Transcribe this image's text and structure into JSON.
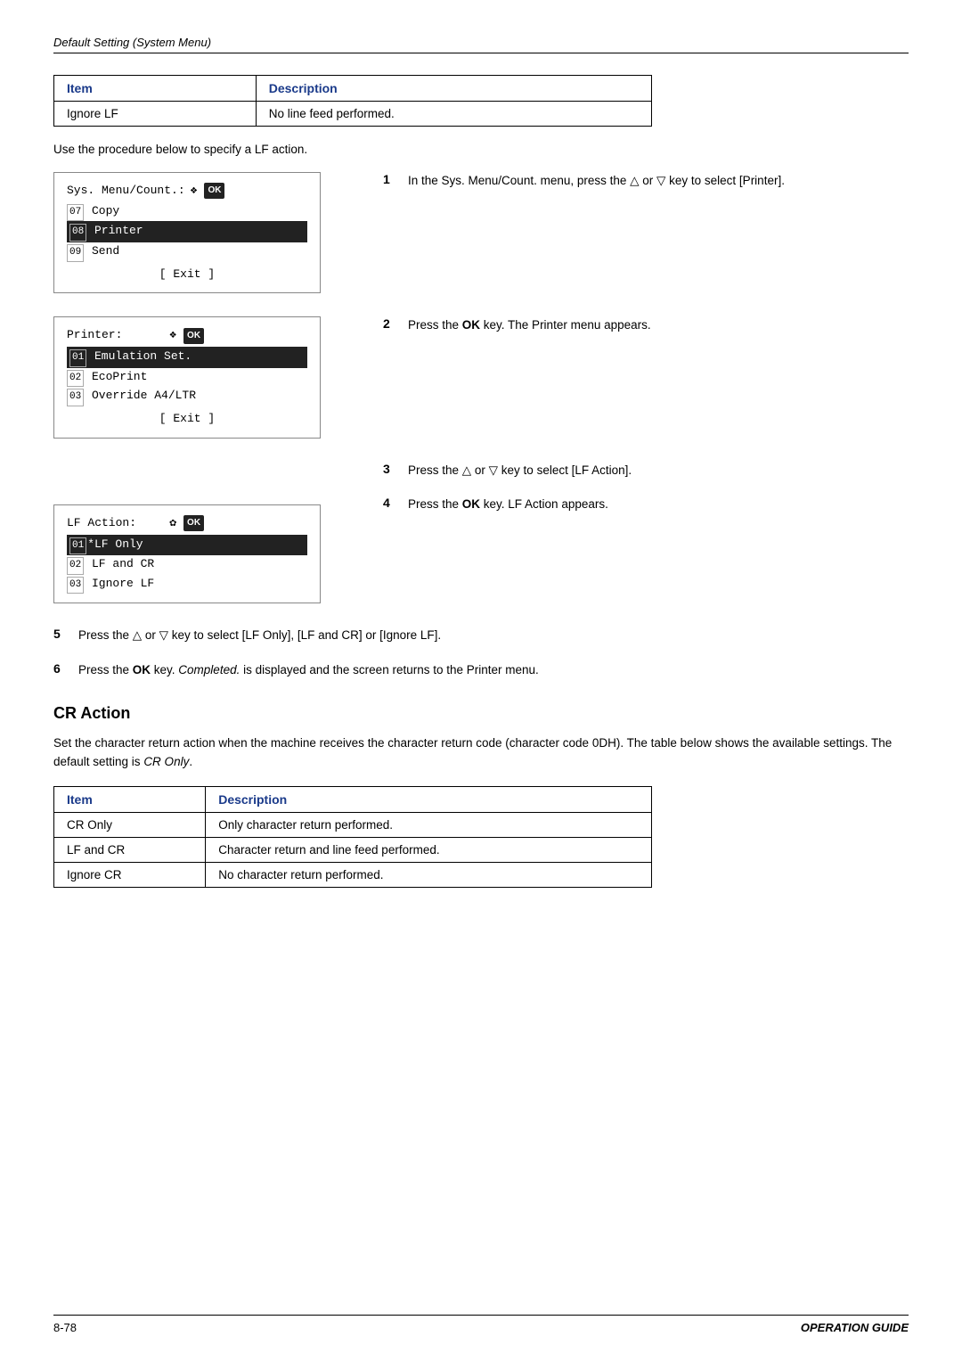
{
  "header": {
    "title": "Default Setting (System Menu)"
  },
  "lf_action_table": {
    "col1": "Item",
    "col2": "Description",
    "rows": [
      {
        "item": "Ignore LF",
        "description": "No line feed performed."
      }
    ]
  },
  "procedure_intro": "Use the procedure below to specify a LF action.",
  "lcd_screens": {
    "screen1": {
      "title": "Sys. Menu/Count.:",
      "rows": [
        {
          "num": "07",
          "text": "Copy",
          "highlighted": false
        },
        {
          "num": "08",
          "text": "Printer",
          "highlighted": true
        },
        {
          "num": "09",
          "text": "Send",
          "highlighted": false
        }
      ],
      "exit": "[ Exit ]"
    },
    "screen2": {
      "title": "Printer:",
      "rows": [
        {
          "num": "01",
          "text": "Emulation Set.",
          "highlighted": true
        },
        {
          "num": "02",
          "text": "EcoPrint",
          "highlighted": false
        },
        {
          "num": "03",
          "text": "Override A4/LTR",
          "highlighted": false
        }
      ],
      "exit": "[ Exit ]"
    },
    "screen3": {
      "title": "LF Action:",
      "rows": [
        {
          "num": "01",
          "text": "*LF Only",
          "highlighted": true
        },
        {
          "num": "02",
          "text": "LF and CR",
          "highlighted": false
        },
        {
          "num": "03",
          "text": "Ignore LF",
          "highlighted": false
        }
      ]
    }
  },
  "steps": [
    {
      "number": "1",
      "text": "In the Sys. Menu/Count. menu, press the △ or ▽ key to select [Printer]."
    },
    {
      "number": "2",
      "text": "Press the OK key. The Printer menu appears."
    },
    {
      "number": "3",
      "text": "Press the △ or ▽ key to select [LF Action]."
    },
    {
      "number": "4",
      "text": "Press the OK key. LF Action appears."
    },
    {
      "number": "5",
      "text": "Press the △ or ▽ key to select [LF Only], [LF and CR] or [Ignore LF]."
    },
    {
      "number": "6",
      "text": "Press the OK key. Completed. is displayed and the screen returns to the Printer menu."
    }
  ],
  "cr_action": {
    "heading": "CR Action",
    "description": "Set the character return action when the machine receives the character return code (character code 0DH). The table below shows the available settings. The default setting is CR Only.",
    "table": {
      "col1": "Item",
      "col2": "Description",
      "rows": [
        {
          "item": "CR Only",
          "description": "Only character return performed."
        },
        {
          "item": "LF and CR",
          "description": "Character return and line feed performed."
        },
        {
          "item": "Ignore CR",
          "description": "No character return performed."
        }
      ]
    }
  },
  "footer": {
    "page": "8-78",
    "guide": "OPERATION GUIDE"
  }
}
